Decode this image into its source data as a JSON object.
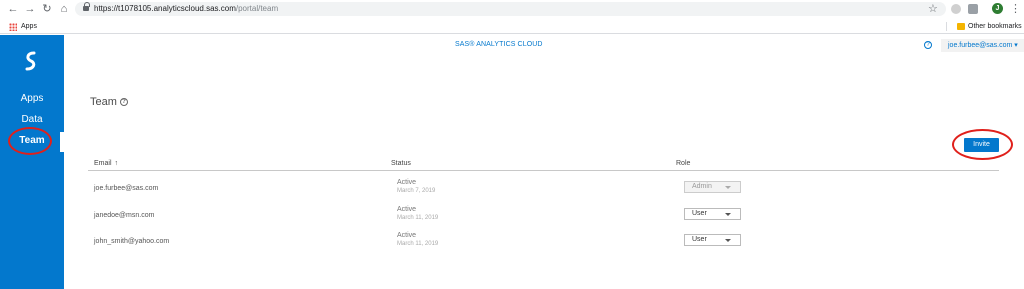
{
  "browser": {
    "url_host": "https://t1078105.analyticscloud.sas.com",
    "url_path": "/portal/team",
    "bookmarks": {
      "apps_label": "Apps",
      "other_label": "Other bookmarks"
    },
    "profile_initial": "J",
    "icons": {
      "back": "back-arrow-icon",
      "forward": "forward-arrow-icon",
      "reload": "reload-icon",
      "home": "home-icon",
      "lock": "lock-icon",
      "star": "star-icon",
      "menu": "kebab-menu-icon"
    }
  },
  "sidebar": {
    "items": [
      {
        "label": "Apps"
      },
      {
        "label": "Data"
      },
      {
        "label": "Team"
      }
    ],
    "active": "Team",
    "accent": "#0378cd"
  },
  "header": {
    "title": "SAS® ANALYTICS CLOUD",
    "help_glyph": "?",
    "user": "joe.furbee@sas.com ▾"
  },
  "page": {
    "title": "Team",
    "help_glyph": "?",
    "invite_label": "Invite"
  },
  "table": {
    "columns": {
      "email": "Email",
      "sort_glyph": "↑",
      "status": "Status",
      "role": "Role"
    },
    "rows": [
      {
        "email": "joe.furbee@sas.com",
        "status": "Active",
        "date": "March 7, 2019",
        "role": "Admin",
        "role_disabled": true
      },
      {
        "email": "janedoe@msn.com",
        "status": "Active",
        "date": "March 11, 2019",
        "role": "User",
        "role_disabled": false
      },
      {
        "email": "john_smith@yahoo.com",
        "status": "Active",
        "date": "March 11, 2019",
        "role": "User",
        "role_disabled": false
      }
    ]
  },
  "annotations": {
    "color": "#e0201b"
  }
}
